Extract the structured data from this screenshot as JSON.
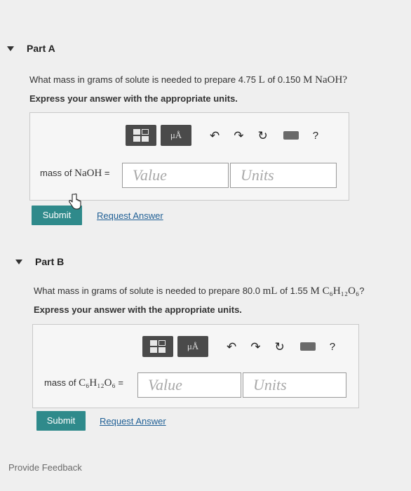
{
  "partA": {
    "title": "Part A",
    "question_pre": "What mass in grams of solute is needed to prepare 4.75",
    "question_unit": "L",
    "question_mid": "of 0.150",
    "question_formula": "M NaOH",
    "question_end": "?",
    "instruction": "Express your answer with the appropriate units.",
    "toolbar": {
      "units_label": "μÅ",
      "help_label": "?"
    },
    "label_pre": "mass of",
    "label_formula": "NaOH",
    "label_eq": "=",
    "value_placeholder": "Value",
    "units_placeholder": "Units",
    "submit_label": "Submit",
    "request_label": "Request Answer"
  },
  "partB": {
    "title": "Part B",
    "question_pre": "What mass in grams of solute is needed to prepare 80.0",
    "question_unit": "mL",
    "question_mid": "of 1.55",
    "question_formula": "M C₆H₁₂O₆",
    "question_end": "?",
    "instruction": "Express your answer with the appropriate units.",
    "toolbar": {
      "units_label": "μÅ",
      "help_label": "?"
    },
    "label_pre": "mass of",
    "label_formula": "C₆H₁₂O₆",
    "label_eq": "=",
    "value_placeholder": "Value",
    "units_placeholder": "Units",
    "submit_label": "Submit",
    "request_label": "Request Answer"
  },
  "footer": {
    "feedback_label": "Provide Feedback"
  },
  "colors": {
    "submit": "#2f8a8b",
    "link": "#1f5f95",
    "toolbar_button": "#4a4a4a"
  }
}
